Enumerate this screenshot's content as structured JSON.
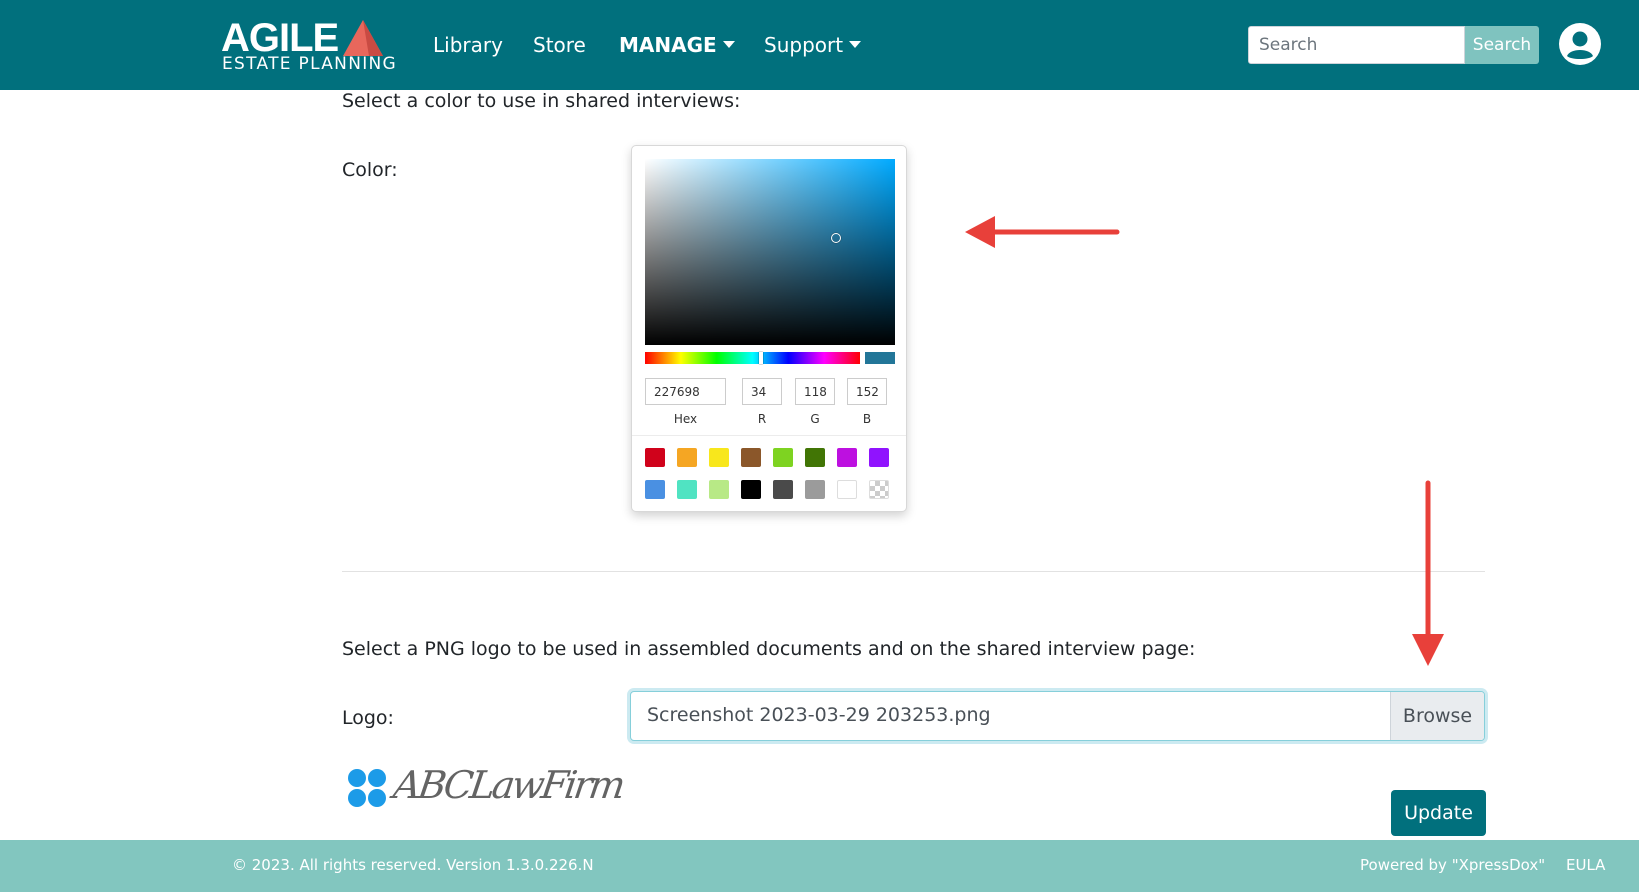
{
  "brand": {
    "name": "AGILE",
    "tagline": "ESTATE PLANNING"
  },
  "nav": {
    "items": [
      {
        "label": "Library"
      },
      {
        "label": "Store"
      },
      {
        "label": "MANAGE"
      },
      {
        "label": "Support"
      }
    ]
  },
  "search": {
    "placeholder": "Search",
    "button_label": "Search"
  },
  "color_section": {
    "instruction": "Select a color to use in shared interviews:",
    "field_label": "Color:"
  },
  "color_picker": {
    "hex": "227698",
    "r": "34",
    "g": "118",
    "b": "152",
    "labels": {
      "hex": "Hex",
      "r": "R",
      "g": "G",
      "b": "B"
    },
    "current_color": "#227698",
    "swatches_row1": [
      "#d0021b",
      "#f5a623",
      "#f8e71c",
      "#8b572a",
      "#7ed321",
      "#417505",
      "#bd10e0",
      "#9013fe"
    ],
    "swatches_row2": [
      "#4a90e2",
      "#50e3c2",
      "#b8e986",
      "#000000",
      "#4a4a4a",
      "#9b9b9b",
      "#ffffff",
      "transparent"
    ]
  },
  "logo_section": {
    "instruction": "Select a PNG logo to be used in assembled documents and on the shared interview page:",
    "field_label": "Logo:",
    "file_name": "Screenshot 2023-03-29 203253.png",
    "browse_label": "Browse",
    "preview_text": "ABCLawFirm"
  },
  "update_label": "Update",
  "footer": {
    "copyright": "© 2023. All rights reserved. Version 1.3.0.226.N",
    "powered_by": "Powered by \"XpressDox\"",
    "eula": "EULA"
  },
  "colors": {
    "navbar": "#01707d",
    "footer": "#82c6bf",
    "accent": "#01707d",
    "arrow": "#e8403a"
  }
}
